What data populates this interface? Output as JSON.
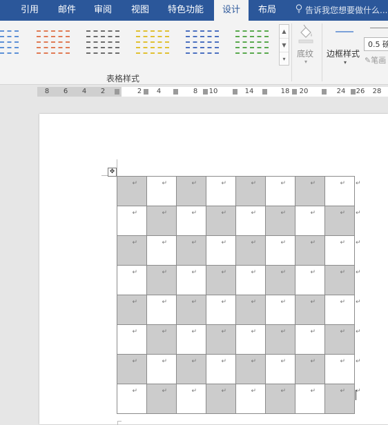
{
  "tabs": [
    "引用",
    "邮件",
    "审阅",
    "视图",
    "特色功能",
    "设计",
    "布局"
  ],
  "active_tab": "设计",
  "tell_me": "告诉我您想要做什么...",
  "colors": {
    "tabbar": "#2b579a",
    "ribbon": "#f3f3f3",
    "style_colors": [
      "#5b8fd6",
      "#e07a53",
      "#6b6b6b",
      "#e0c030",
      "#4a6fc0",
      "#58a84c"
    ]
  },
  "ribbon": {
    "group_label": "表格样式",
    "shading_label": "底纹",
    "border_style_label": "边框样式",
    "weight_value": "0.5 磅",
    "pen_label": "笔画"
  },
  "icons": [
    "paint-bucket-icon",
    "move-handle-icon",
    "pen-icon",
    "bulb-icon"
  ],
  "ruler": {
    "numbers": [
      "8",
      "6",
      "4",
      "2",
      "2",
      "4",
      "8",
      "10",
      "14",
      "18",
      "20",
      "24",
      "26",
      "28"
    ]
  },
  "table": {
    "rows": 8,
    "cols": 8,
    "cell_mark": "↵",
    "first_cell_shaded": true
  }
}
